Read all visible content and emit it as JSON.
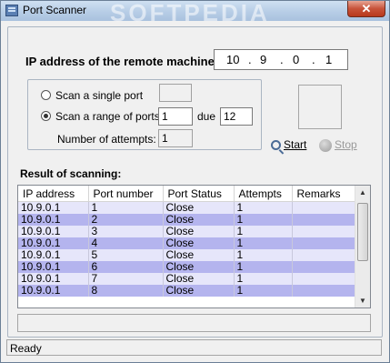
{
  "window": {
    "title": "Port Scanner",
    "close_label": "✕",
    "watermark": "SOFTPEDIA"
  },
  "ip": {
    "label": "IP address of the remote machine:",
    "octets": [
      "10",
      "9",
      "0",
      "1"
    ]
  },
  "options": {
    "single_label": "Scan a single port",
    "single_value": "",
    "range_label": "Scan a range of ports",
    "range_from": "1",
    "due_label": "due",
    "range_to": "12",
    "attempts_label": "Number of attempts:",
    "attempts_value": "1",
    "selected": "range"
  },
  "actions": {
    "start_label": "Start",
    "stop_label": "Stop"
  },
  "results": {
    "label": "Result of scanning:",
    "columns": [
      "IP address",
      "Port number",
      "Port Status",
      "Attempts",
      "Remarks"
    ],
    "rows": [
      [
        "10.9.0.1",
        "1",
        "Close",
        "1",
        ""
      ],
      [
        "10.9.0.1",
        "2",
        "Close",
        "1",
        ""
      ],
      [
        "10.9.0.1",
        "3",
        "Close",
        "1",
        ""
      ],
      [
        "10.9.0.1",
        "4",
        "Close",
        "1",
        ""
      ],
      [
        "10.9.0.1",
        "5",
        "Close",
        "1",
        ""
      ],
      [
        "10.9.0.1",
        "6",
        "Close",
        "1",
        ""
      ],
      [
        "10.9.0.1",
        "7",
        "Close",
        "1",
        ""
      ],
      [
        "10.9.0.1",
        "8",
        "Close",
        "1",
        ""
      ]
    ]
  },
  "status": {
    "text": "Ready"
  },
  "colors": {
    "row_light": "#e6e6fa",
    "row_dark": "#b4b4ee",
    "title_bar": "#b7cde6",
    "close_button": "#c7533a"
  }
}
